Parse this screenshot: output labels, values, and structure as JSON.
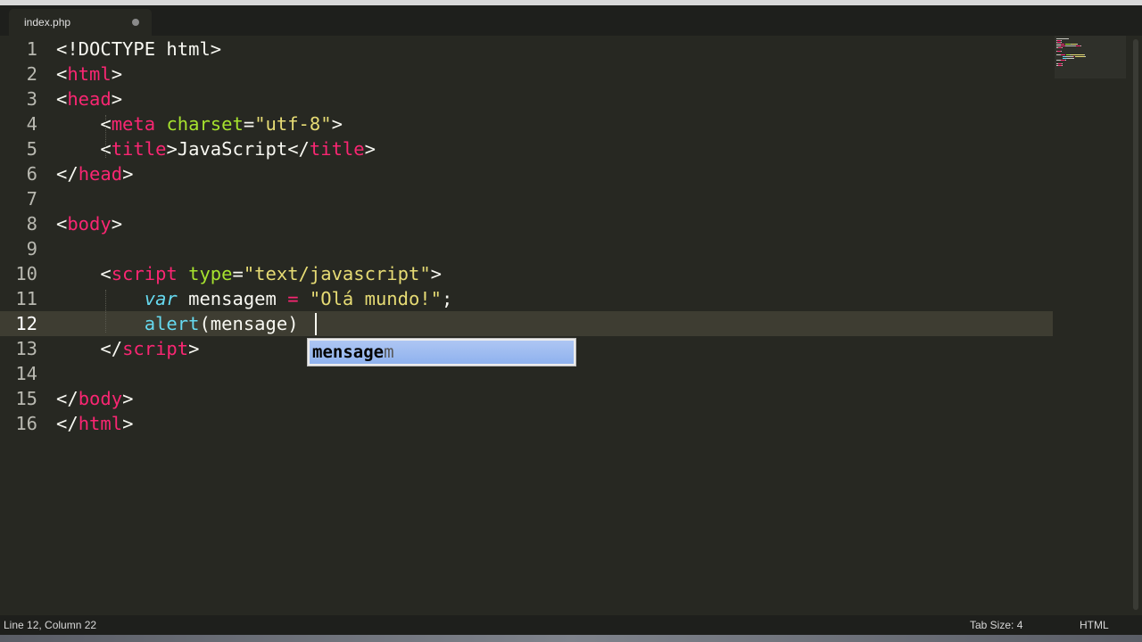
{
  "tab": {
    "filename": "index.php"
  },
  "editor": {
    "current_line": 12,
    "lines": [
      {
        "n": "1",
        "tokens": [
          {
            "t": "<!DOCTYPE html>",
            "c": "plain"
          }
        ]
      },
      {
        "n": "2",
        "tokens": [
          {
            "t": "<",
            "c": "plain"
          },
          {
            "t": "html",
            "c": "tag"
          },
          {
            "t": ">",
            "c": "plain"
          }
        ]
      },
      {
        "n": "3",
        "tokens": [
          {
            "t": "<",
            "c": "plain"
          },
          {
            "t": "head",
            "c": "tag"
          },
          {
            "t": ">",
            "c": "plain"
          }
        ]
      },
      {
        "n": "4",
        "tokens": [
          {
            "t": "    <",
            "c": "plain"
          },
          {
            "t": "meta",
            "c": "tag"
          },
          {
            "t": " ",
            "c": "plain"
          },
          {
            "t": "charset",
            "c": "attr"
          },
          {
            "t": "=",
            "c": "plain"
          },
          {
            "t": "\"utf-8\"",
            "c": "str"
          },
          {
            "t": ">",
            "c": "plain"
          }
        ]
      },
      {
        "n": "5",
        "tokens": [
          {
            "t": "    <",
            "c": "plain"
          },
          {
            "t": "title",
            "c": "tag"
          },
          {
            "t": ">JavaScript</",
            "c": "plain"
          },
          {
            "t": "title",
            "c": "tag"
          },
          {
            "t": ">",
            "c": "plain"
          }
        ]
      },
      {
        "n": "6",
        "tokens": [
          {
            "t": "</",
            "c": "plain"
          },
          {
            "t": "head",
            "c": "tag"
          },
          {
            "t": ">",
            "c": "plain"
          }
        ]
      },
      {
        "n": "7",
        "tokens": []
      },
      {
        "n": "8",
        "tokens": [
          {
            "t": "<",
            "c": "plain"
          },
          {
            "t": "body",
            "c": "tag"
          },
          {
            "t": ">",
            "c": "plain"
          }
        ]
      },
      {
        "n": "9",
        "tokens": []
      },
      {
        "n": "10",
        "tokens": [
          {
            "t": "    <",
            "c": "plain"
          },
          {
            "t": "script",
            "c": "tag"
          },
          {
            "t": " ",
            "c": "plain"
          },
          {
            "t": "type",
            "c": "attr"
          },
          {
            "t": "=",
            "c": "plain"
          },
          {
            "t": "\"text/javascript\"",
            "c": "str"
          },
          {
            "t": ">",
            "c": "plain"
          }
        ]
      },
      {
        "n": "11",
        "tokens": [
          {
            "t": "        ",
            "c": "plain"
          },
          {
            "t": "var",
            "c": "kw"
          },
          {
            "t": " mensagem ",
            "c": "plain"
          },
          {
            "t": "=",
            "c": "op"
          },
          {
            "t": " ",
            "c": "plain"
          },
          {
            "t": "\"Olá mundo!\"",
            "c": "str"
          },
          {
            "t": ";",
            "c": "plain"
          }
        ]
      },
      {
        "n": "12",
        "tokens": [
          {
            "t": "        ",
            "c": "plain"
          },
          {
            "t": "alert",
            "c": "fn"
          },
          {
            "t": "(mensage)",
            "c": "plain"
          }
        ]
      },
      {
        "n": "13",
        "tokens": [
          {
            "t": "    </",
            "c": "plain"
          },
          {
            "t": "script",
            "c": "tag"
          },
          {
            "t": ">",
            "c": "plain"
          }
        ]
      },
      {
        "n": "14",
        "tokens": []
      },
      {
        "n": "15",
        "tokens": [
          {
            "t": "</",
            "c": "plain"
          },
          {
            "t": "body",
            "c": "tag"
          },
          {
            "t": ">",
            "c": "plain"
          }
        ]
      },
      {
        "n": "16",
        "tokens": [
          {
            "t": "</",
            "c": "plain"
          },
          {
            "t": "html",
            "c": "tag"
          },
          {
            "t": ">",
            "c": "plain"
          }
        ]
      }
    ]
  },
  "autocomplete": {
    "match": "mensage",
    "rest": "m"
  },
  "status": {
    "position": "Line 12, Column 22",
    "tab_size": "Tab Size: 4",
    "syntax": "HTML"
  },
  "colors": {
    "background": "#272822",
    "tag": "#f92672",
    "attribute": "#a6e22e",
    "string": "#e6db74",
    "keyword": "#66d9ef"
  }
}
